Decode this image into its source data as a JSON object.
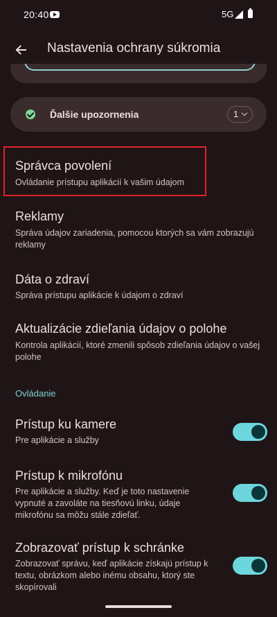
{
  "status_bar": {
    "time": "20:40",
    "network": "5G",
    "icons": [
      "youtube-icon",
      "signal-icon",
      "battery-icon"
    ]
  },
  "app_bar": {
    "title": "Nastavenia ochrany súkromia",
    "back_icon": "arrow-back-icon"
  },
  "alerts_card": {
    "label": "Ďalšie upozornenia",
    "count": "1"
  },
  "preferences": [
    {
      "title": "Správca povolení",
      "summary": "Ovládanie prístupu aplikácií k vašim údajom",
      "highlighted": true
    },
    {
      "title": "Reklamy",
      "summary": "Správa údajov zariadenia, pomocou ktorých sa vám zobrazujú reklamy"
    },
    {
      "title": "Dáta o zdraví",
      "summary": "Správa prístupu aplikácie k údajom o zdraví"
    },
    {
      "title": "Aktualizácie zdieľania údajov o polohe",
      "summary": "Kontrola aplikácií, ktoré zmenili spôsob zdieľania údajov o vašej polohe"
    }
  ],
  "controls_section": {
    "header": "Ovládanie",
    "items": [
      {
        "title": "Prístup ku kamere",
        "summary": "Pre aplikácie a služby",
        "enabled": true
      },
      {
        "title": "Prístup k mikrofónu",
        "summary": "Pre aplikácie a služby. Keď je toto nastavenie vypnuté a zavoláte na tiesňovú linku, údaje mikrofónu sa môžu stále zdieľať.",
        "enabled": true
      },
      {
        "title": "Zobrazovať prístup k schránke",
        "summary": "Zobrazovať správu, keď aplikácie získajú prístup k textu, obrázkom alebo inému obsahu, ktorý ste skopírovali",
        "enabled": true
      }
    ]
  },
  "colors": {
    "background": "#1f1516",
    "card": "#3a2c2d",
    "accent": "#7ed3d4",
    "toggle_track": "#6dd6dd",
    "highlight_border": "#e3202a",
    "check": "#7ed89a"
  }
}
